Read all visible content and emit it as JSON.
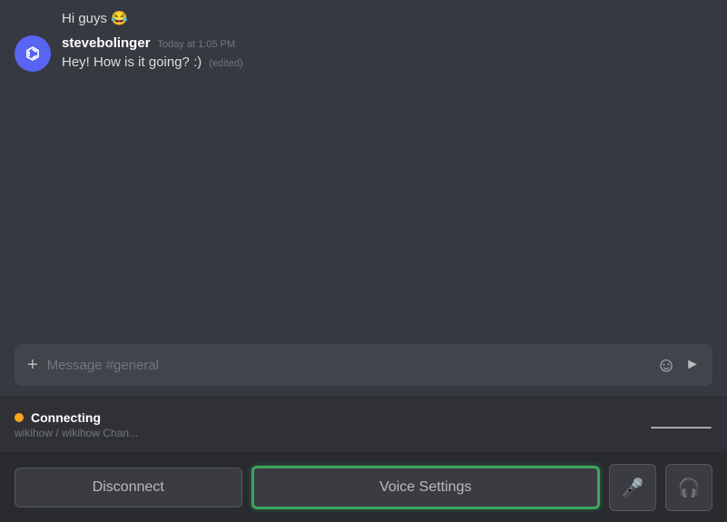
{
  "chat": {
    "messages": [
      {
        "id": "msg1",
        "text": "Hi guys 😂",
        "avatar_type": "yellow",
        "avatar_emoji": ""
      },
      {
        "id": "msg2",
        "username": "stevebolinger",
        "timestamp": "Today at 1:05 PM",
        "text": "Hey! How is it going? :)",
        "edited": "(edited)",
        "avatar_type": "discord"
      }
    ]
  },
  "input": {
    "placeholder": "Message #general"
  },
  "voice": {
    "status": "Connecting",
    "channel": "wikihow / wikihow Chan..."
  },
  "actions": {
    "disconnect_label": "Disconnect",
    "voice_settings_label": "Voice Settings",
    "mic_icon": "🎤",
    "headphone_icon": "🎧"
  }
}
